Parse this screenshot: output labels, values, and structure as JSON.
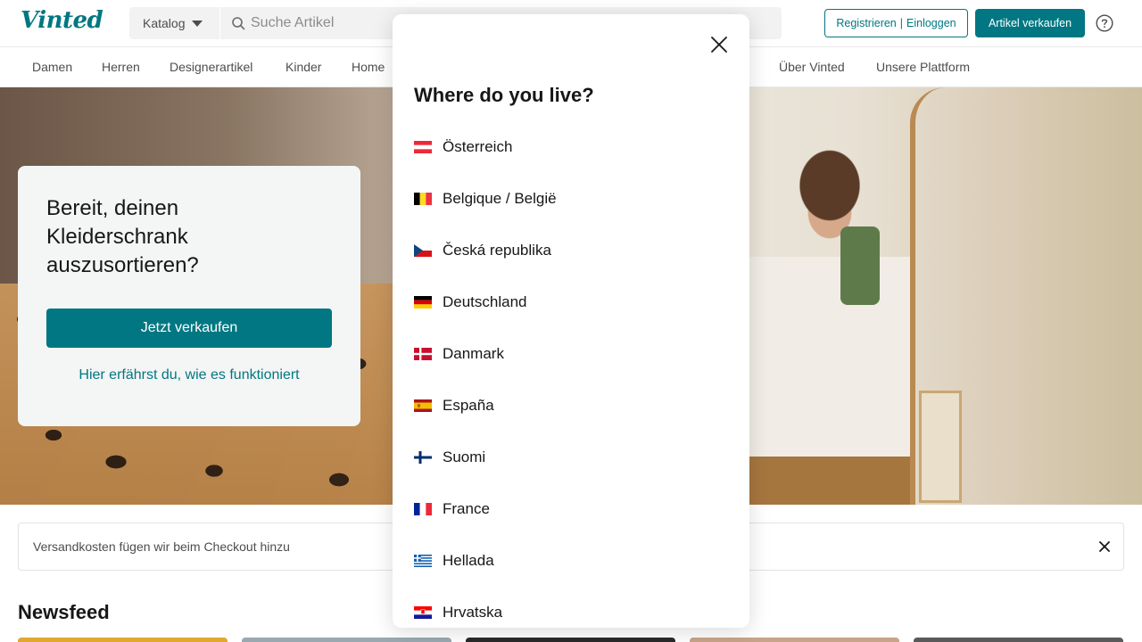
{
  "header": {
    "logo": "Vinted",
    "catalog_label": "Katalog",
    "search_placeholder": "Suche Artikel",
    "register_label": "Registrieren",
    "login_label": "Einloggen",
    "auth_separator": "|",
    "sell_label": "Artikel verkaufen"
  },
  "nav": {
    "items": [
      "Damen",
      "Herren",
      "Designerartikel",
      "Kinder",
      "Home",
      "Über Vinted",
      "Unsere Plattform"
    ]
  },
  "hero": {
    "title": "Bereit, deinen Kleiderschrank auszusortieren?",
    "cta_label": "Jetzt verkaufen",
    "link_label": "Hier erfährst du, wie es funktioniert"
  },
  "notice": {
    "text": "Versandkosten fügen wir beim Checkout hinzu"
  },
  "newsfeed": {
    "title": "Newsfeed"
  },
  "modal": {
    "title": "Where do you live?",
    "countries": [
      {
        "label": "Österreich",
        "flag": "at"
      },
      {
        "label": "Belgique / België",
        "flag": "be"
      },
      {
        "label": "Česká republika",
        "flag": "cz"
      },
      {
        "label": "Deutschland",
        "flag": "de"
      },
      {
        "label": "Danmark",
        "flag": "dk"
      },
      {
        "label": "España",
        "flag": "es"
      },
      {
        "label": "Suomi",
        "flag": "fi"
      },
      {
        "label": "France",
        "flag": "fr"
      },
      {
        "label": "Hellada",
        "flag": "gr"
      },
      {
        "label": "Hrvatska",
        "flag": "hr"
      }
    ]
  },
  "colors": {
    "brand": "#007782",
    "text": "#171717",
    "muted": "#4d4d4d"
  }
}
